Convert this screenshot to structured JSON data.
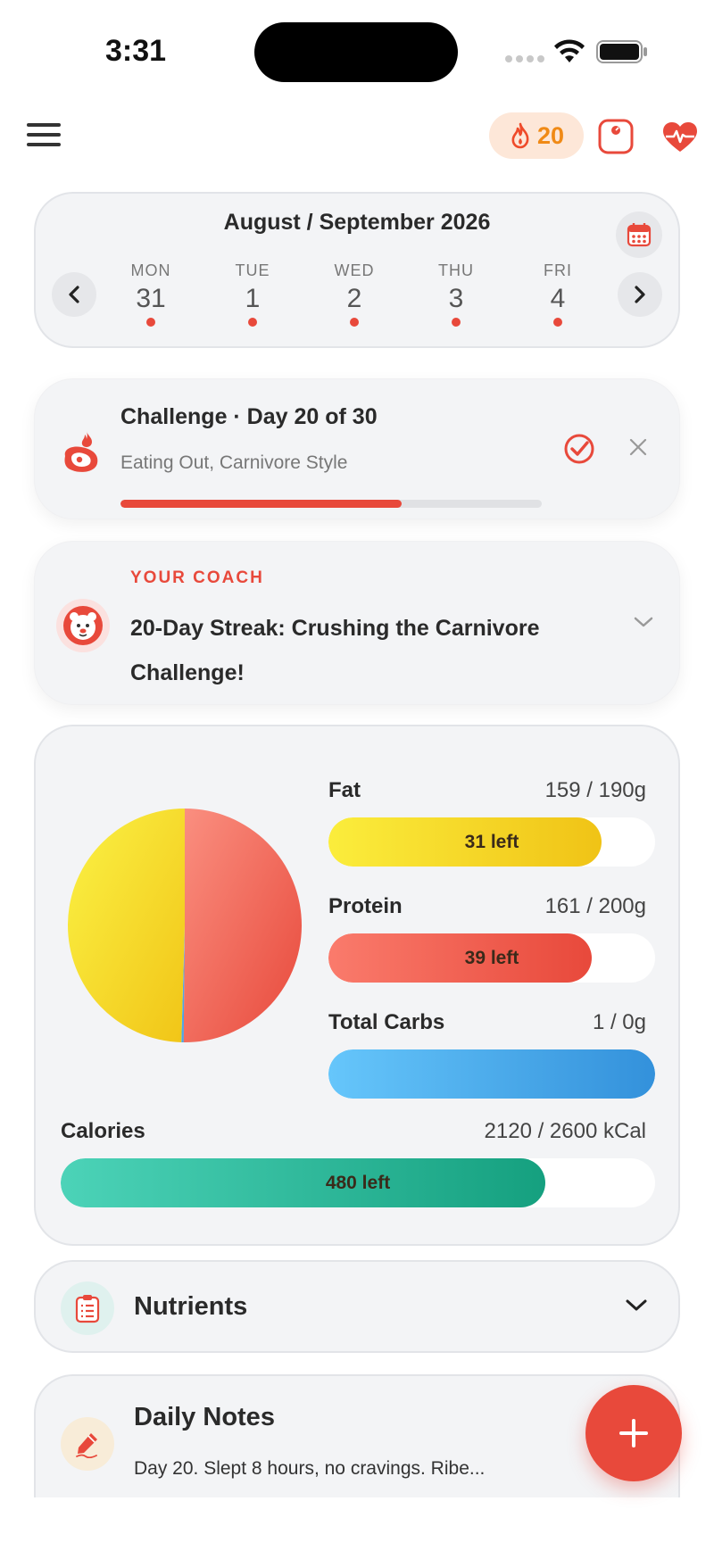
{
  "status_bar": {
    "time": "3:31"
  },
  "header": {
    "streak_count": "20",
    "icons": [
      "menu-icon",
      "flame-icon",
      "scale-icon",
      "heart-pulse-icon"
    ]
  },
  "calendar": {
    "title": "August / September 2026",
    "days": [
      {
        "dow": "MON",
        "num": "31"
      },
      {
        "dow": "TUE",
        "num": "1"
      },
      {
        "dow": "WED",
        "num": "2"
      },
      {
        "dow": "THU",
        "num": "3"
      },
      {
        "dow": "FRI",
        "num": "4"
      }
    ]
  },
  "challenge": {
    "title": "Challenge · Day 20 of 30",
    "subtitle": "Eating Out, Carnivore Style",
    "progress": 0.667
  },
  "coach": {
    "label": "YOUR COACH",
    "headline": "20-Day Streak: Crushing the Carnivore Challenge!"
  },
  "macros": {
    "fat": {
      "name": "Fat",
      "value": "159 / 190g",
      "left": "31 left",
      "fraction": 0.837,
      "color_start": "#fbed3c",
      "color_end": "#f0c316"
    },
    "protein": {
      "name": "Protein",
      "value": "161 / 200g",
      "left": "39 left",
      "fraction": 0.805,
      "color_start": "#fa7b6c",
      "color_end": "#e8493b"
    },
    "carbs": {
      "name": "Total Carbs",
      "value": "1 / 0g",
      "left": "",
      "fraction": 1.0,
      "color_start": "#66c6fb",
      "color_end": "#3391db"
    },
    "calories": {
      "name": "Calories",
      "value": "2120 / 2600 kCal",
      "left": "480 left",
      "fraction": 0.815,
      "color_start": "#4cd3b8",
      "color_end": "#15a07f"
    }
  },
  "chart_data": {
    "type": "pie",
    "categories": [
      "Fat",
      "Protein",
      "Total Carbs"
    ],
    "values": [
      159,
      161,
      1
    ],
    "colors": [
      "#f5d626",
      "#f06a5a",
      "#5fb3f0"
    ]
  },
  "nutrients": {
    "title": "Nutrients"
  },
  "notes": {
    "title": "Daily Notes",
    "preview": "Day 20. Slept 8 hours, no cravings. Ribe..."
  },
  "fab": {
    "label": "+"
  }
}
